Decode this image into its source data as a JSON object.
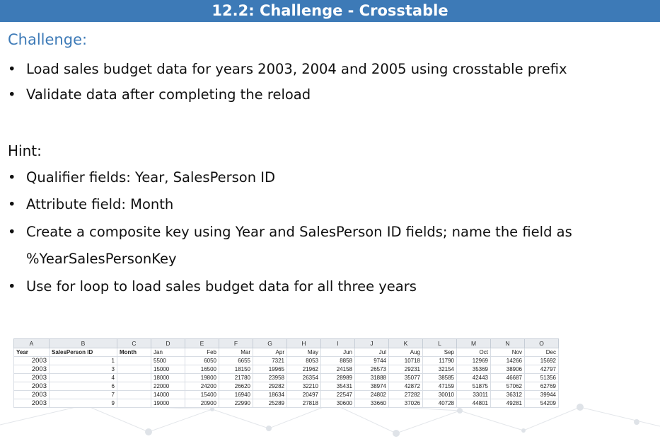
{
  "title": "12.2: Challenge - Crosstable",
  "challenge": {
    "heading": "Challenge:",
    "bullets": [
      "Load sales budget data for years 2003, 2004 and 2005 using crosstable prefix",
      "Validate data after completing the reload"
    ]
  },
  "hint": {
    "heading": "Hint:",
    "bullets": [
      "Qualifier fields: Year, SalesPerson ID",
      "Attribute field: Month",
      "Create a composite key using Year and SalesPerson ID fields; name the field as",
      "%YearSalesPersonKey",
      "Use for loop to load sales budget data for all three years"
    ]
  },
  "bullet_glyph": "•",
  "spreadsheet": {
    "columns": [
      "A",
      "B",
      "C",
      "D",
      "E",
      "F",
      "G",
      "H",
      "I",
      "J",
      "K",
      "L",
      "M",
      "N",
      "O"
    ],
    "header": [
      "Year",
      "SalesPerson ID",
      "Month",
      "Jan",
      "Feb",
      "Mar",
      "Apr",
      "May",
      "Jun",
      "Jul",
      "Aug",
      "Sep",
      "Oct",
      "Nov",
      "Dec"
    ],
    "rows": [
      [
        "2003",
        "1",
        "",
        "5500",
        "6050",
        "6655",
        "7321",
        "8053",
        "8858",
        "9744",
        "10718",
        "11790",
        "12969",
        "14266",
        "15692"
      ],
      [
        "2003",
        "3",
        "",
        "15000",
        "16500",
        "18150",
        "19965",
        "21962",
        "24158",
        "26573",
        "29231",
        "32154",
        "35369",
        "38906",
        "42797"
      ],
      [
        "2003",
        "4",
        "",
        "18000",
        "19800",
        "21780",
        "23958",
        "26354",
        "28989",
        "31888",
        "35077",
        "38585",
        "42443",
        "46687",
        "51356"
      ],
      [
        "2003",
        "6",
        "",
        "22000",
        "24200",
        "26620",
        "29282",
        "32210",
        "35431",
        "38974",
        "42872",
        "47159",
        "51875",
        "57062",
        "62769"
      ],
      [
        "2003",
        "7",
        "",
        "14000",
        "15400",
        "16940",
        "18634",
        "20497",
        "22547",
        "24802",
        "27282",
        "30010",
        "33011",
        "36312",
        "39944"
      ],
      [
        "2003",
        "9",
        "",
        "19000",
        "20900",
        "22990",
        "25289",
        "27818",
        "30600",
        "33660",
        "37026",
        "40728",
        "44801",
        "49281",
        "54209"
      ]
    ]
  }
}
